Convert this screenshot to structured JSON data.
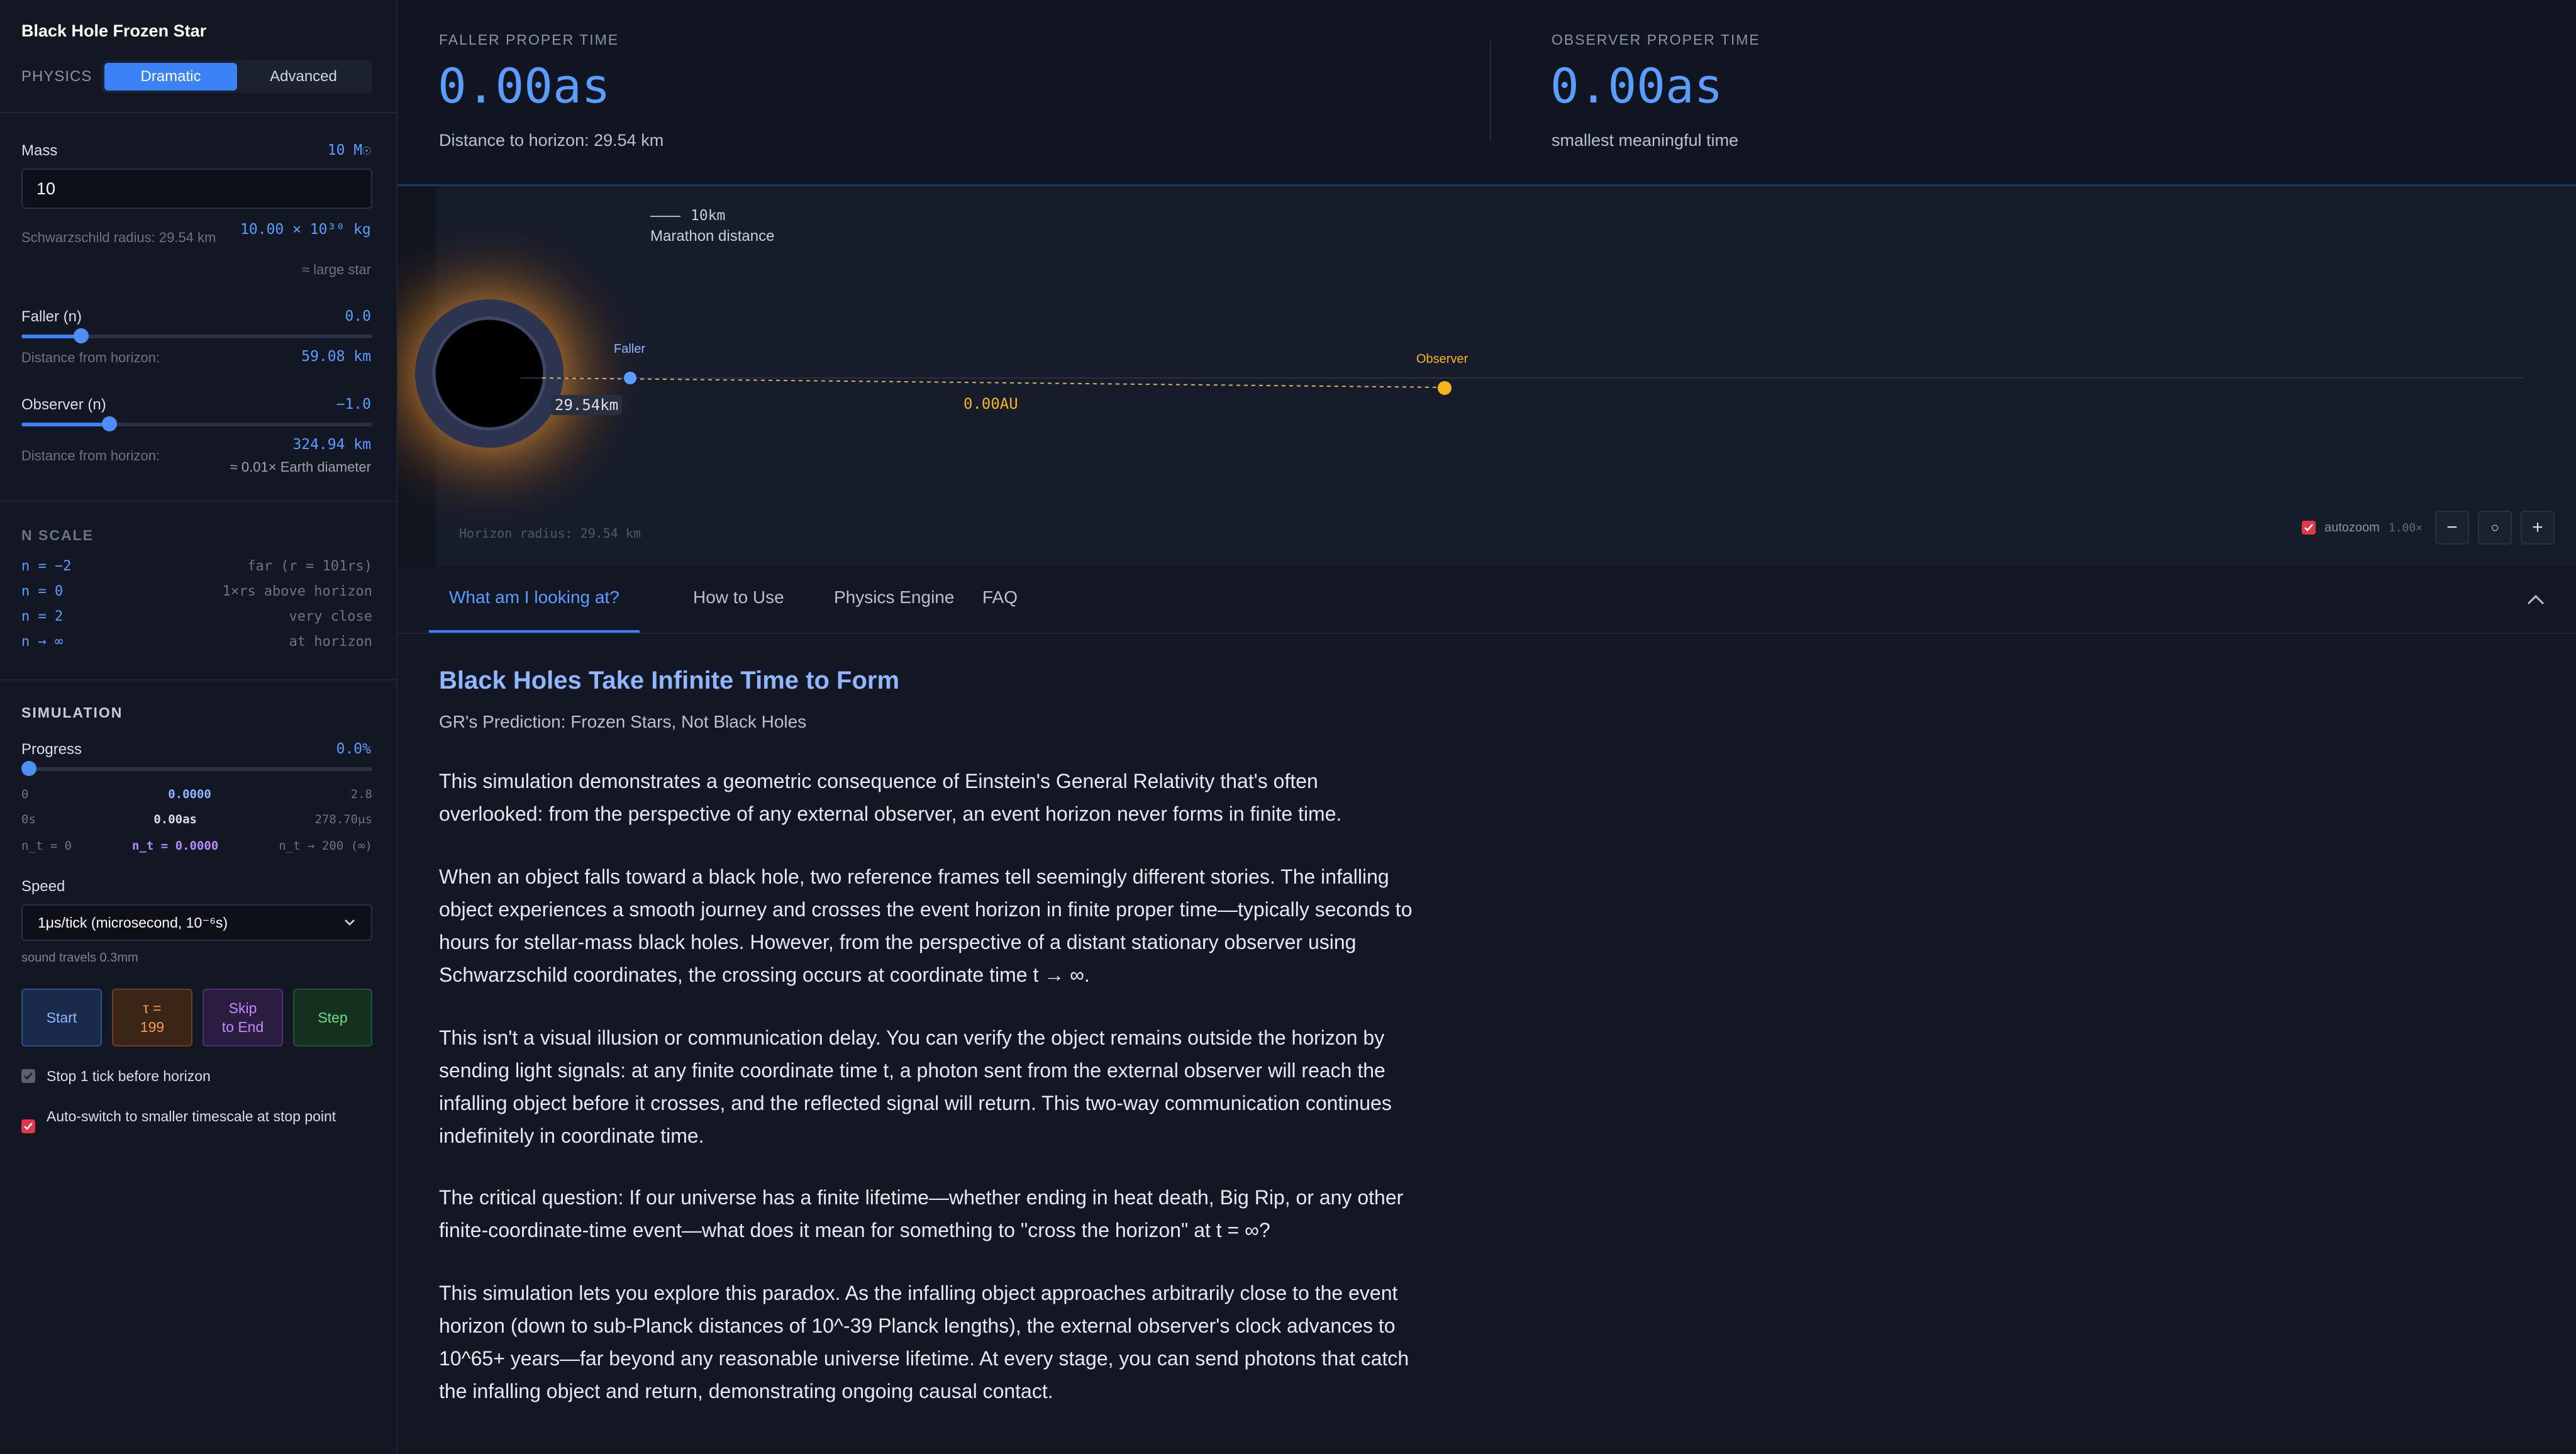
{
  "sidebar": {
    "title": "Black Hole Frozen Star",
    "physics_label": "PHYSICS",
    "mode_dramatic": "Dramatic",
    "mode_advanced": "Advanced",
    "mass": {
      "label": "Mass",
      "value_badge": "10 M☉",
      "input_value": "10",
      "schwarz": "Schwarzschild radius: 29.54 km",
      "kg": "10.00 × 10³⁰ kg",
      "approx": "≈ large star"
    },
    "faller": {
      "label": "Faller (n)",
      "value": "0.0",
      "dist_label": "Distance from horizon:",
      "dist_value": "59.08 km",
      "slider_fraction": 0.17
    },
    "observer": {
      "label": "Observer (n)",
      "value": "−1.0",
      "dist_label": "Distance from horizon:",
      "dist_value": "324.94 km",
      "approx": "≈ 0.01× Earth diameter",
      "slider_fraction": 0.25
    },
    "nscale": {
      "heading": "N SCALE",
      "rows": [
        {
          "k": "n = −2",
          "v": "far (r = 101rs)"
        },
        {
          "k": "n = 0",
          "v": "1×rs above horizon"
        },
        {
          "k": "n = 2",
          "v": "very close"
        },
        {
          "k": "n → ∞",
          "v": "at horizon"
        }
      ]
    },
    "simulation": {
      "heading": "SIMULATION",
      "progress_label": "Progress",
      "progress_value": "0.0%",
      "progress_fraction": 0.0,
      "row1": [
        "0",
        "0.0000",
        "2.8"
      ],
      "row2": [
        "0s",
        "0.00as",
        "278.70μs"
      ],
      "row3": [
        "n_t = 0",
        "n_t = 0.0000",
        "n_t → 200 (∞)"
      ],
      "speed_label": "Speed",
      "speed_value": "1μs/tick (microsecond, 10⁻⁶s)",
      "speed_note": "sound travels 0.3mm",
      "btn_start": "Start",
      "btn_tau": "τ =\n199",
      "btn_skip": "Skip\nto End",
      "btn_step": "Step",
      "chk_stop": "Stop 1 tick before horizon",
      "chk_auto": "Auto-switch to smaller timescale at stop point"
    }
  },
  "stats": {
    "faller_label": "FALLER PROPER TIME",
    "faller_value": "0.00as",
    "faller_sub": "Distance to horizon: 29.54 km",
    "observer_label": "OBSERVER PROPER TIME",
    "observer_value": "0.00as",
    "observer_sub": "smallest meaningful time"
  },
  "viz": {
    "scale_label": "10km",
    "scale_note": "Marathon distance",
    "faller_label": "Faller",
    "observer_label": "Observer",
    "radius_tag": "29.54km",
    "distance_tag": "0.00AU",
    "horizon_note": "Horizon radius: 29.54 km",
    "autozoom_label": "autozoom",
    "zoom_value": "1.00×",
    "zoom_out": "−",
    "zoom_reset": "○",
    "zoom_in": "+"
  },
  "tabs": [
    "What am I looking at?",
    "How to Use",
    "Physics Engine",
    "FAQ"
  ],
  "content": {
    "title": "Black Holes Take Infinite Time to Form",
    "subtitle": "GR's Prediction: Frozen Stars, Not Black Holes",
    "paragraphs": [
      "This simulation demonstrates a geometric consequence of Einstein's General Relativity that's often overlooked: from the perspective of any external observer, an event horizon never forms in finite time.",
      "When an object falls toward a black hole, two reference frames tell seemingly different stories. The infalling object experiences a smooth journey and crosses the event horizon in finite proper time—typically seconds to hours for stellar-mass black holes. However, from the perspective of a distant stationary observer using Schwarzschild coordinates, the crossing occurs at coordinate time t → ∞.",
      "This isn't a visual illusion or communication delay. You can verify the object remains outside the horizon by sending light signals: at any finite coordinate time t, a photon sent from the external observer will reach the infalling object before it crosses, and the reflected signal will return. This two-way communication continues indefinitely in coordinate time.",
      "The critical question: If our universe has a finite lifetime—whether ending in heat death, Big Rip, or any other finite-coordinate-time event—what does it mean for something to \"cross the horizon\" at t = ∞?",
      "This simulation lets you explore this paradox. As the infalling object approaches arbitrarily close to the event horizon (down to sub-Planck distances of 10^-39 Planck lengths), the external observer's clock advances to 10^65+ years—far beyond any reasonable universe lifetime. At every stage, you can send photons that catch the infalling object and return, demonstrating ongoing causal contact."
    ]
  },
  "colors": {
    "accent": "#3b82f6",
    "observer": "#f5b521",
    "faller": "#5b9dff"
  }
}
